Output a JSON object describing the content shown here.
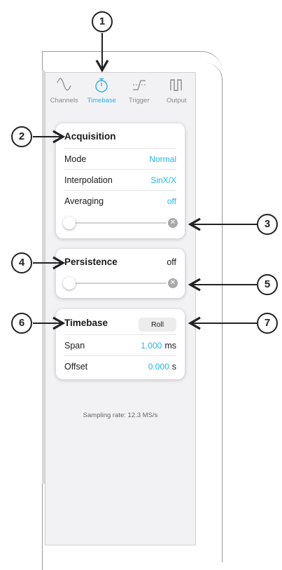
{
  "tabs": [
    {
      "label": "Channels",
      "icon": "sine-wave-icon",
      "active": false
    },
    {
      "label": "Timebase",
      "icon": "stopwatch-icon",
      "active": true
    },
    {
      "label": "Trigger",
      "icon": "trigger-edge-icon",
      "active": false
    },
    {
      "label": "Output",
      "icon": "square-wave-icon",
      "active": false
    }
  ],
  "acquisition": {
    "title": "Acquisition",
    "rows": [
      {
        "label": "Mode",
        "value": "Normal"
      },
      {
        "label": "Interpolation",
        "value": "SinX/X"
      },
      {
        "label": "Averaging",
        "value": "off"
      }
    ],
    "slider_level": 0,
    "clear_glyph": "✕"
  },
  "persistence": {
    "title": "Persistence",
    "value": "off",
    "slider_level": 0,
    "clear_glyph": "✕"
  },
  "timebase": {
    "title": "Timebase",
    "roll_label": "Roll",
    "rows": [
      {
        "label": "Span",
        "value": "1.000",
        "unit": "ms"
      },
      {
        "label": "Offset",
        "value": "0.000",
        "unit": "s"
      }
    ]
  },
  "sampling_rate": "Sampling rate: 12.3 MS/s",
  "callouts": [
    "1",
    "2",
    "3",
    "4",
    "5",
    "6",
    "7"
  ],
  "colors": {
    "accent": "#27b4e3",
    "callout": "#222222"
  }
}
